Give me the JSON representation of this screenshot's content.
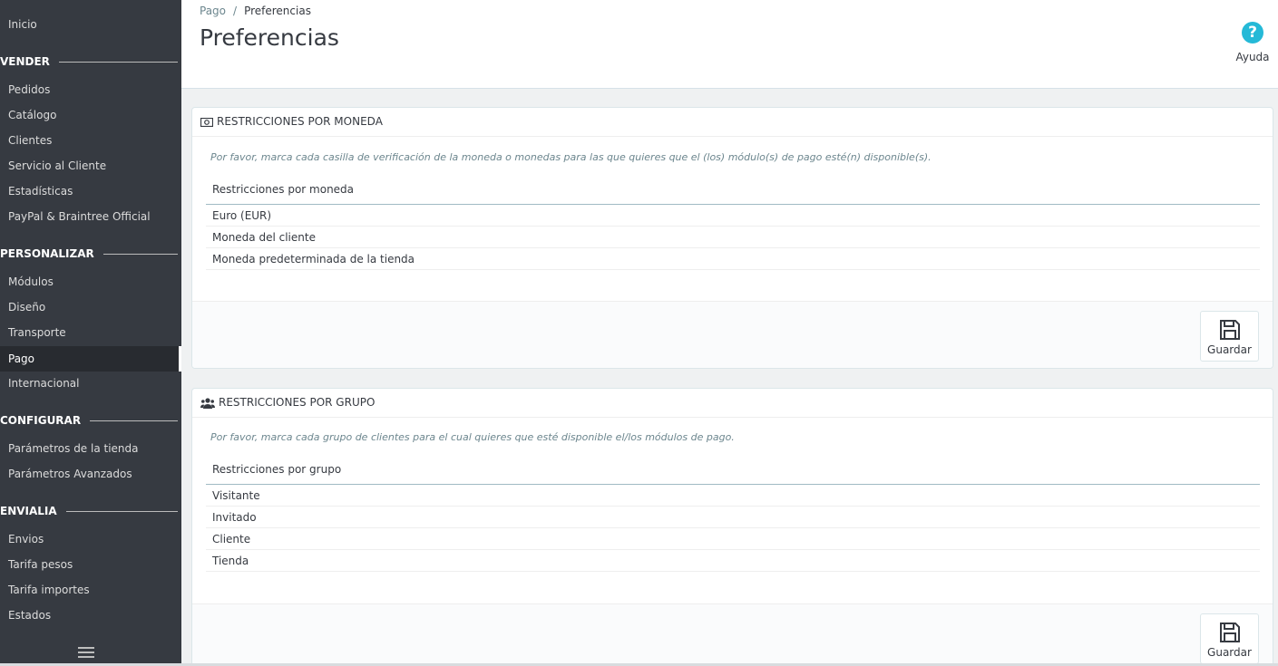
{
  "sidebar": {
    "items": [
      {
        "label": "Inicio"
      },
      {
        "section": "VENDER"
      },
      {
        "label": "Pedidos"
      },
      {
        "label": "Catálogo"
      },
      {
        "label": "Clientes"
      },
      {
        "label": "Servicio al Cliente"
      },
      {
        "label": "Estadísticas"
      },
      {
        "label": "PayPal & Braintree Official"
      },
      {
        "section": "PERSONALIZAR"
      },
      {
        "label": "Módulos"
      },
      {
        "label": "Diseño"
      },
      {
        "label": "Transporte"
      },
      {
        "label": "Pago",
        "active": true
      },
      {
        "label": "Internacional"
      },
      {
        "section": "CONFIGURAR"
      },
      {
        "label": "Parámetros de la tienda"
      },
      {
        "label": "Parámetros Avanzados"
      },
      {
        "section": "ENVIALIA"
      },
      {
        "label": "Envios"
      },
      {
        "label": "Tarifa pesos"
      },
      {
        "label": "Tarifa importes"
      },
      {
        "label": "Estados"
      }
    ]
  },
  "header": {
    "breadcrumb": [
      "Pago",
      "Preferencias"
    ],
    "breadcrumb_sep": "/",
    "title": "Preferencias",
    "help_label": "Ayuda",
    "help_glyph": "?"
  },
  "panels": {
    "currency": {
      "title": "RESTRICCIONES POR MONEDA",
      "description": "Por favor, marca cada casilla de verificación de la moneda o monedas para las que quieres que el (los) módulo(s) de pago esté(n) disponible(s).",
      "column_header": "Restricciones por moneda",
      "rows": [
        "Euro (EUR)",
        "Moneda del cliente",
        "Moneda predeterminada de la tienda"
      ],
      "save_label": "Guardar"
    },
    "group": {
      "title": "RESTRICCIONES POR GRUPO",
      "description": "Por favor, marca cada grupo de clientes para el cual quieres que esté disponible el/los módulos de pago.",
      "column_header": "Restricciones por grupo",
      "rows": [
        "Visitante",
        "Invitado",
        "Cliente",
        "Tienda"
      ],
      "save_label": "Guardar"
    }
  },
  "colors": {
    "sidebar_bg": "#363a41",
    "accent": "#25b9d7"
  }
}
